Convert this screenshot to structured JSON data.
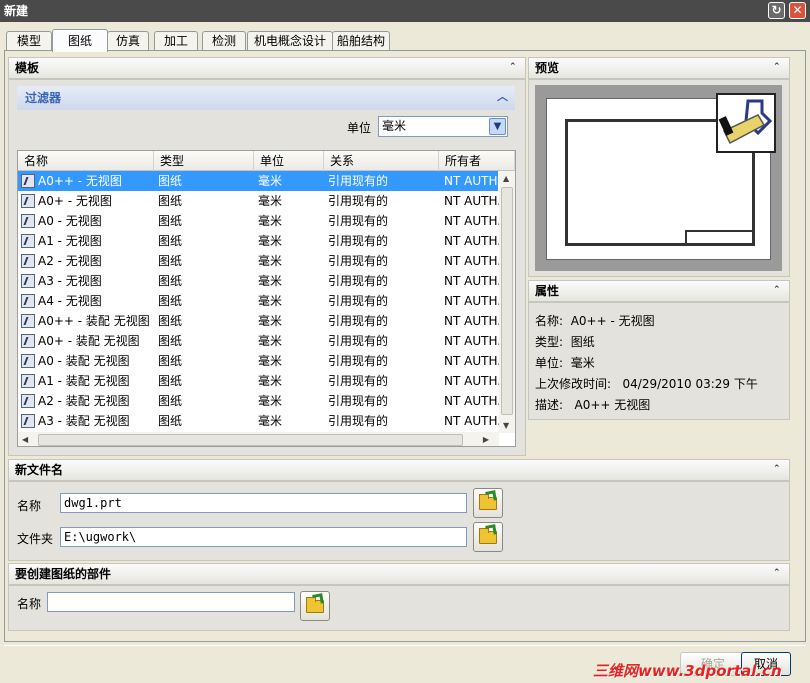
{
  "window": {
    "title": "新建",
    "help_icon": "help-icon",
    "close_icon": "close-icon"
  },
  "tabs": [
    {
      "label": "模型"
    },
    {
      "label": "图纸",
      "active": true
    },
    {
      "label": "仿真"
    },
    {
      "label": "加工"
    },
    {
      "label": "检测"
    },
    {
      "label": "机电概念设计"
    },
    {
      "label": "船舶结构"
    }
  ],
  "template": {
    "header": "模板",
    "filter": {
      "header": "过滤器",
      "unit_label": "单位",
      "unit_value": "毫米"
    },
    "columns": [
      "名称",
      "类型",
      "单位",
      "关系",
      "所有者"
    ],
    "rows": [
      {
        "name": "A0++ - 无视图",
        "type": "图纸",
        "unit": "毫米",
        "relation": "引用现有的",
        "owner": "NT AUTH...",
        "selected": true
      },
      {
        "name": "A0+ - 无视图",
        "type": "图纸",
        "unit": "毫米",
        "relation": "引用现有的",
        "owner": "NT AUTH..."
      },
      {
        "name": "A0 - 无视图",
        "type": "图纸",
        "unit": "毫米",
        "relation": "引用现有的",
        "owner": "NT AUTH..."
      },
      {
        "name": "A1 - 无视图",
        "type": "图纸",
        "unit": "毫米",
        "relation": "引用现有的",
        "owner": "NT AUTH..."
      },
      {
        "name": "A2 - 无视图",
        "type": "图纸",
        "unit": "毫米",
        "relation": "引用现有的",
        "owner": "NT AUTH..."
      },
      {
        "name": "A3 - 无视图",
        "type": "图纸",
        "unit": "毫米",
        "relation": "引用现有的",
        "owner": "NT AUTH..."
      },
      {
        "name": "A4 - 无视图",
        "type": "图纸",
        "unit": "毫米",
        "relation": "引用现有的",
        "owner": "NT AUTH..."
      },
      {
        "name": "A0++ - 装配 无视图",
        "type": "图纸",
        "unit": "毫米",
        "relation": "引用现有的",
        "owner": "NT AUTH..."
      },
      {
        "name": "A0+ - 装配 无视图",
        "type": "图纸",
        "unit": "毫米",
        "relation": "引用现有的",
        "owner": "NT AUTH..."
      },
      {
        "name": "A0 - 装配 无视图",
        "type": "图纸",
        "unit": "毫米",
        "relation": "引用现有的",
        "owner": "NT AUTH..."
      },
      {
        "name": "A1 - 装配 无视图",
        "type": "图纸",
        "unit": "毫米",
        "relation": "引用现有的",
        "owner": "NT AUTH..."
      },
      {
        "name": "A2 - 装配 无视图",
        "type": "图纸",
        "unit": "毫米",
        "relation": "引用现有的",
        "owner": "NT AUTH..."
      },
      {
        "name": "A3 - 装配 无视图",
        "type": "图纸",
        "unit": "毫米",
        "relation": "引用现有的",
        "owner": "NT AUTH..."
      }
    ]
  },
  "preview": {
    "header": "预览"
  },
  "properties": {
    "header": "属性",
    "name_label": "名称:",
    "name_value": "A0++ - 无视图",
    "type_label": "类型:",
    "type_value": "图纸",
    "unit_label": "单位:",
    "unit_value": "毫米",
    "modified_label": "上次修改时间:",
    "modified_value": "04/29/2010 03:29 下午",
    "desc_label": "描述:",
    "desc_value": "A0++ 无视图"
  },
  "new_file": {
    "header": "新文件名",
    "name_label": "名称",
    "name_value": "dwg1.prt",
    "folder_label": "文件夹",
    "folder_value": "E:\\ugwork\\"
  },
  "part": {
    "header": "要创建图纸的部件",
    "name_label": "名称",
    "name_value": ""
  },
  "buttons": {
    "ok": "确定",
    "cancel": "取消"
  },
  "watermark": "三维网www.3dportal.cn",
  "colors": {
    "selection": "#3399ff",
    "filter_header": "#3a64b8",
    "title_bar": "#4a4a4a"
  }
}
